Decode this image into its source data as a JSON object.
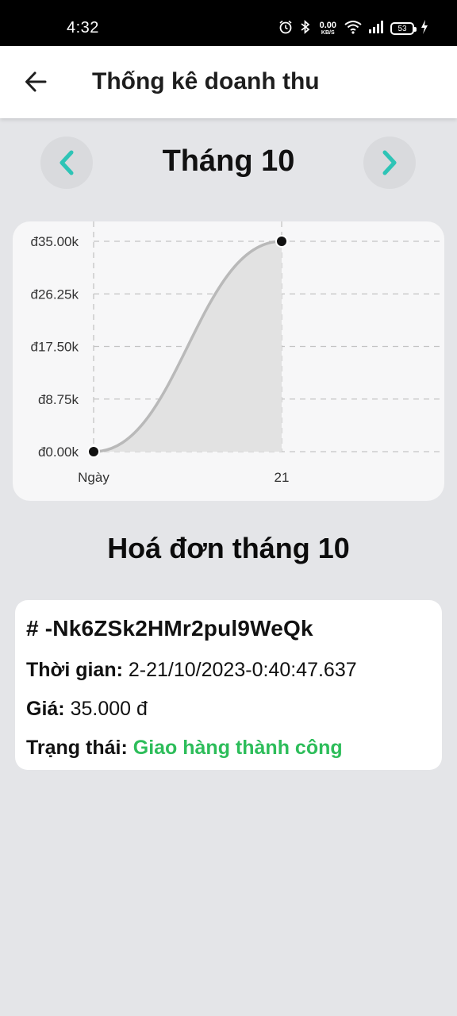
{
  "status_bar": {
    "time": "4:32",
    "net_speed_value": "0.00",
    "net_speed_unit": "KB/S",
    "battery_level": "53"
  },
  "app_bar": {
    "title": "Thống kê doanh thu"
  },
  "month_nav": {
    "title": "Tháng 10"
  },
  "chart_data": {
    "type": "area",
    "x_ticks": [
      "Ngày",
      "21"
    ],
    "points": [
      {
        "x": "Ngày",
        "y": 0
      },
      {
        "x": "21",
        "y": 35000
      }
    ],
    "y_ticks": [
      "đ0.00k",
      "đ8.75k",
      "đ17.50k",
      "đ26.25k",
      "đ35.00k"
    ],
    "y_tick_values": [
      0,
      8750,
      17500,
      26250,
      35000
    ],
    "ylim": [
      0,
      35000
    ],
    "grid": true,
    "line_color": "#b9b9b9",
    "fill_color": "#e2e2e2",
    "point_color": "#111111"
  },
  "invoices": {
    "heading": "Hoá đơn tháng 10",
    "items": [
      {
        "id": "# -Nk6ZSk2HMr2pul9WeQk",
        "time_label": "Thời gian:",
        "time_value": "2-21/10/2023-0:40:47.637",
        "price_label": "Giá:",
        "price_value": "35.000 đ",
        "status_label": "Trạng thái:",
        "status_value": "Giao hàng thành công",
        "status_color": "#2dbd5a"
      }
    ]
  },
  "colors": {
    "background": "#e4e5e8",
    "accent": "#2ec4b6"
  }
}
